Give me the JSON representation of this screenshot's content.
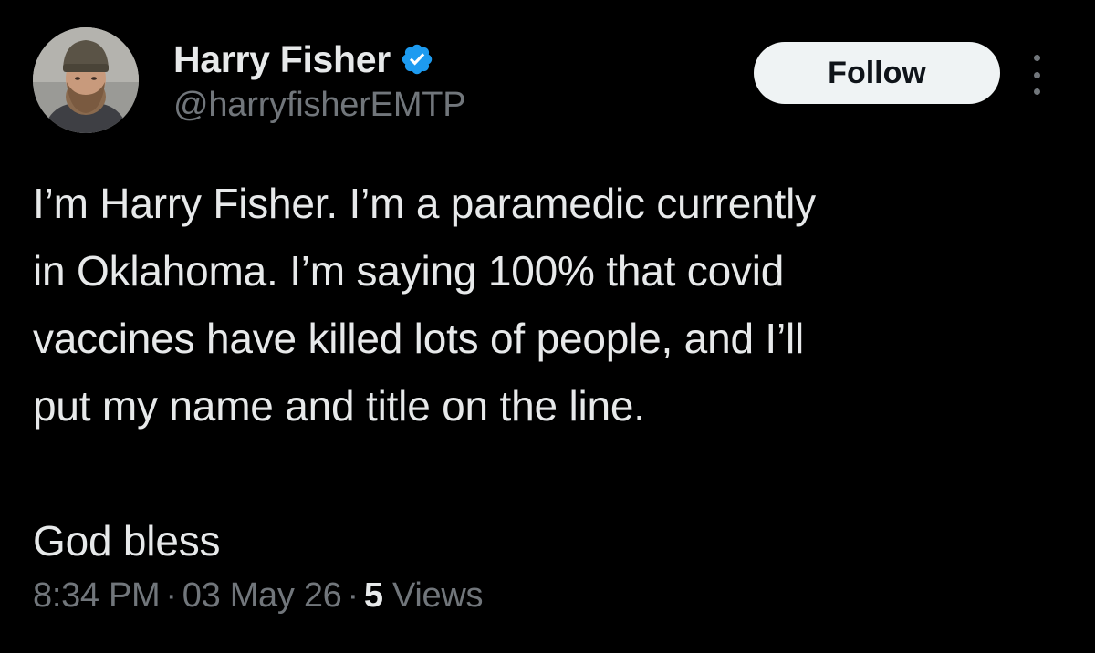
{
  "author": {
    "display_name": "Harry Fisher",
    "handle": "@harryfisherEMTP",
    "verified": true,
    "verified_color": "#1d9bf0"
  },
  "actions": {
    "follow_label": "Follow",
    "more_icon": "more-horizontal-dots"
  },
  "tweet": {
    "lines": [
      "I’m Harry Fisher. I’m a paramedic currently",
      "in Oklahoma. I’m saying 100% that covid",
      "vaccines have killed lots of people, and I’ll",
      "put my name and title on the line."
    ],
    "closing": "God bless"
  },
  "meta": {
    "time": "8:34 PM",
    "date": "03 May 26",
    "separator": "·",
    "views_count": "5",
    "views_label": "Views"
  },
  "colors": {
    "background": "#000000",
    "text_primary": "#e7e9ea",
    "text_secondary": "#71767b",
    "follow_bg": "#eff3f4"
  }
}
